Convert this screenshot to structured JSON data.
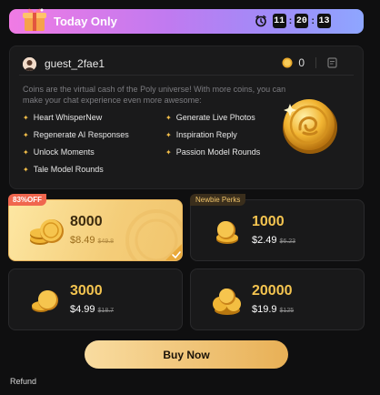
{
  "promo": {
    "title": "Today Only",
    "timer": {
      "hours": "11",
      "minutes": "20",
      "seconds": "13"
    }
  },
  "user": {
    "name": "guest_2fae1",
    "coin_balance": "0"
  },
  "info": {
    "description": "Coins are the virtual cash of the Poly universe! With more coins, you can make your chat experience even more awesome:",
    "perks": [
      "Heart WhisperNew",
      "Generate Live Photos",
      "Regenerate AI Responses",
      "Inspiration Reply",
      "Unlock Moments",
      "Passion Model Rounds",
      "Tale Model Rounds"
    ]
  },
  "packages": [
    {
      "badge": "83%OFF",
      "coins": "8000",
      "price": "$8.49",
      "old_price": "$49.8",
      "selected": true
    },
    {
      "badge": "Newbie Perks",
      "coins": "1000",
      "price": "$2.49",
      "old_price": "$6.23",
      "selected": false
    },
    {
      "badge": "",
      "coins": "3000",
      "price": "$4.99",
      "old_price": "$18.7",
      "selected": false
    },
    {
      "badge": "",
      "coins": "20000",
      "price": "$19.9",
      "old_price": "$125",
      "selected": false
    }
  ],
  "buy_label": "Buy Now",
  "refund_label": "Refund",
  "colors": {
    "accent_gold": "#f4c450",
    "promo_pink": "#f07be4",
    "promo_blue": "#8ea6ff",
    "discount_red": "#f0664e"
  }
}
